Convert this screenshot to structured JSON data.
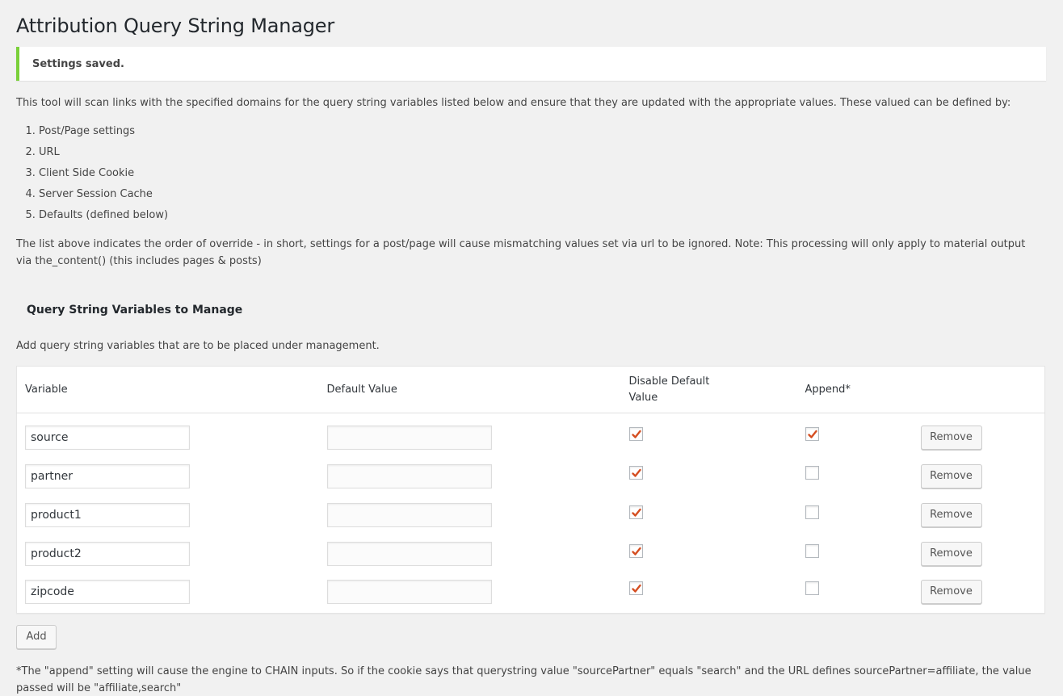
{
  "page": {
    "title": "Attribution Query String Manager"
  },
  "notice": {
    "message": "Settings saved.",
    "accent_color": "#7ad03a"
  },
  "intro": {
    "text": "This tool will scan links with the specified domains for the query string variables listed below and ensure that they are updated with the appropriate values. These valued can be defined by:",
    "sources": [
      "Post/Page settings",
      "URL",
      "Client Side Cookie",
      "Server Session Cache",
      "Defaults (defined below)"
    ],
    "override_note": "The list above indicates the order of override - in short, settings for a post/page will cause mismatching values set via url to be ignored. Note: This processing will only apply to material output via the_content() (this includes pages & posts)"
  },
  "section": {
    "heading": "Query String Variables to Manage",
    "description": "Add query string variables that are to be placed under management."
  },
  "table": {
    "headers": {
      "variable": "Variable",
      "default_value": "Default Value",
      "disable_default": "Disable Default Value",
      "append": "Append*"
    },
    "rows": [
      {
        "variable": "source",
        "default_value": "",
        "disable_default": true,
        "append": true,
        "remove_label": "Remove"
      },
      {
        "variable": "partner",
        "default_value": "",
        "disable_default": true,
        "append": false,
        "remove_label": "Remove"
      },
      {
        "variable": "product1",
        "default_value": "",
        "disable_default": true,
        "append": false,
        "remove_label": "Remove"
      },
      {
        "variable": "product2",
        "default_value": "",
        "disable_default": true,
        "append": false,
        "remove_label": "Remove"
      },
      {
        "variable": "zipcode",
        "default_value": "",
        "disable_default": true,
        "append": false,
        "remove_label": "Remove"
      }
    ],
    "check_color": "#d54e21"
  },
  "actions": {
    "add_label": "Add"
  },
  "footnote": "*The \"append\" setting will cause the engine to CHAIN inputs. So if the cookie says that querystring value \"sourcePartner\" equals \"search\" and the URL defines sourcePartner=affiliate, the value passed will be \"affiliate,search\""
}
